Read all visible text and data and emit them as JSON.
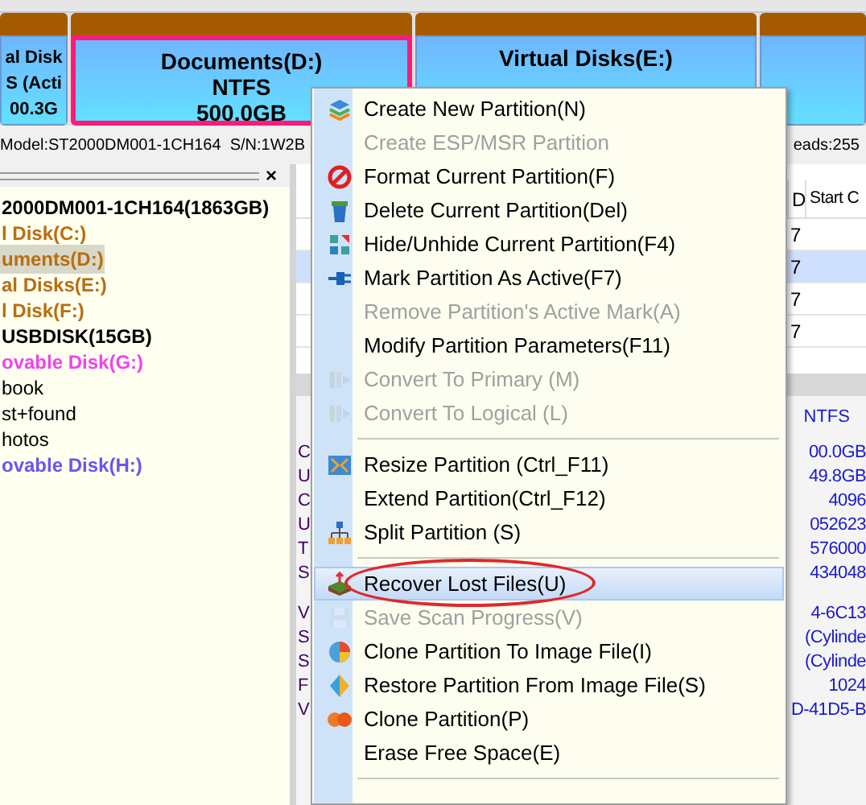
{
  "disk_map": {
    "partitions": [
      {
        "lines": [
          "al Disk",
          "S (Acti",
          "00.3G"
        ],
        "selected": false
      },
      {
        "lines": [
          "Documents(D:)",
          "NTFS",
          "500.0GB"
        ],
        "selected": true
      },
      {
        "lines": [
          "Virtual Disks(E:)"
        ],
        "selected": false
      },
      {
        "selected": false
      }
    ]
  },
  "disk_info": {
    "left": "Model:ST2000DM001-1CH164  S/N:1W2B",
    "right": "eads:255"
  },
  "tree": {
    "close": "×",
    "items": [
      {
        "label": "2000DM001-1CH164(1863GB)",
        "kind": "disk",
        "selected": false,
        "children": [
          {
            "label": "l Disk(C:)",
            "kind": "partition",
            "color": "#b86e10",
            "selected": false
          },
          {
            "label": "uments(D:)",
            "kind": "partition",
            "color": "#b86e10",
            "selected": true
          },
          {
            "label": "al Disks(E:)",
            "kind": "partition",
            "color": "#b86e10",
            "selected": false
          },
          {
            "label": "l Disk(F:)",
            "kind": "partition",
            "color": "#b86e10",
            "selected": false
          }
        ]
      },
      {
        "label": "USBDISK(15GB)",
        "kind": "disk",
        "selected": false,
        "children": [
          {
            "label": "ovable Disk(G:)",
            "kind": "partition",
            "color": "#ee44ee",
            "selected": false,
            "children": [
              {
                "label": "book",
                "kind": "folder",
                "selected": false
              },
              {
                "label": "st+found",
                "kind": "folder",
                "selected": false
              },
              {
                "label": "hotos",
                "kind": "folder",
                "selected": false
              }
            ]
          },
          {
            "label": "ovable Disk(H:)",
            "kind": "partition",
            "color": "#6a55ee",
            "selected": false
          }
        ]
      }
    ]
  },
  "partition_table": {
    "columns": [
      "D",
      "Start C"
    ],
    "rows": [
      {
        "column_1": "7",
        "selected": false
      },
      {
        "column_1": "7",
        "selected": true
      },
      {
        "column_1": "7",
        "selected": false
      },
      {
        "column_1": "7",
        "selected": false
      }
    ]
  },
  "properties": {
    "file_system": "NTFS",
    "rows": [
      {
        "label": "C",
        "value": "00.0GB"
      },
      {
        "label": "U",
        "value": "49.8GB"
      },
      {
        "label": "C",
        "value": "4096"
      },
      {
        "label": "U",
        "value": "052623"
      },
      {
        "label": "T",
        "value": "576000"
      },
      {
        "label": "S",
        "value": "434048"
      },
      {
        "label": "V",
        "value": "4-6C13"
      },
      {
        "label": "S",
        "value": "(Cylinde"
      },
      {
        "label": "S",
        "value": "(Cylinde"
      },
      {
        "label": "F",
        "value": "1024"
      },
      {
        "label": "V",
        "value": "D-41D5-B"
      }
    ]
  },
  "context_menu": {
    "items": [
      {
        "kind": "item",
        "label": "Create New Partition(N)",
        "disabled": false,
        "selected": false
      },
      {
        "kind": "item",
        "label": "Create ESP/MSR Partition",
        "disabled": true,
        "selected": false
      },
      {
        "kind": "item",
        "label": "Format Current Partition(F)",
        "disabled": false,
        "selected": false
      },
      {
        "kind": "item",
        "label": "Delete Current Partition(Del)",
        "disabled": false,
        "selected": false
      },
      {
        "kind": "item",
        "label": "Hide/Unhide Current Partition(F4)",
        "disabled": false,
        "selected": false
      },
      {
        "kind": "item",
        "label": "Mark Partition As Active(F7)",
        "disabled": false,
        "selected": false
      },
      {
        "kind": "item",
        "label": "Remove Partition's Active Mark(A)",
        "disabled": true,
        "selected": false
      },
      {
        "kind": "item",
        "label": "Modify Partition Parameters(F11)",
        "disabled": false,
        "selected": false
      },
      {
        "kind": "item",
        "label": "Convert To Primary (M)",
        "disabled": true,
        "selected": false
      },
      {
        "kind": "item",
        "label": "Convert To Logical (L)",
        "disabled": true,
        "selected": false
      },
      {
        "kind": "separator"
      },
      {
        "kind": "item",
        "label": "Resize Partition (Ctrl_F11)",
        "disabled": false,
        "selected": false
      },
      {
        "kind": "item",
        "label": "Extend Partition(Ctrl_F12)",
        "disabled": false,
        "selected": false
      },
      {
        "kind": "item",
        "label": "Split Partition (S)",
        "disabled": false,
        "selected": false
      },
      {
        "kind": "separator"
      },
      {
        "kind": "item",
        "label": "Recover Lost Files(U)",
        "disabled": false,
        "selected": true,
        "circled": true
      },
      {
        "kind": "item",
        "label": "Save Scan Progress(V)",
        "disabled": true,
        "selected": false
      },
      {
        "kind": "item",
        "label": "Clone Partition To Image File(I)",
        "disabled": false,
        "selected": false
      },
      {
        "kind": "item",
        "label": "Restore Partition From Image File(S)",
        "disabled": false,
        "selected": false
      },
      {
        "kind": "item",
        "label": "Clone Partition(P)",
        "disabled": false,
        "selected": false
      },
      {
        "kind": "item",
        "label": "Erase Free Space(E)",
        "disabled": false,
        "selected": false
      },
      {
        "kind": "separator"
      }
    ]
  }
}
